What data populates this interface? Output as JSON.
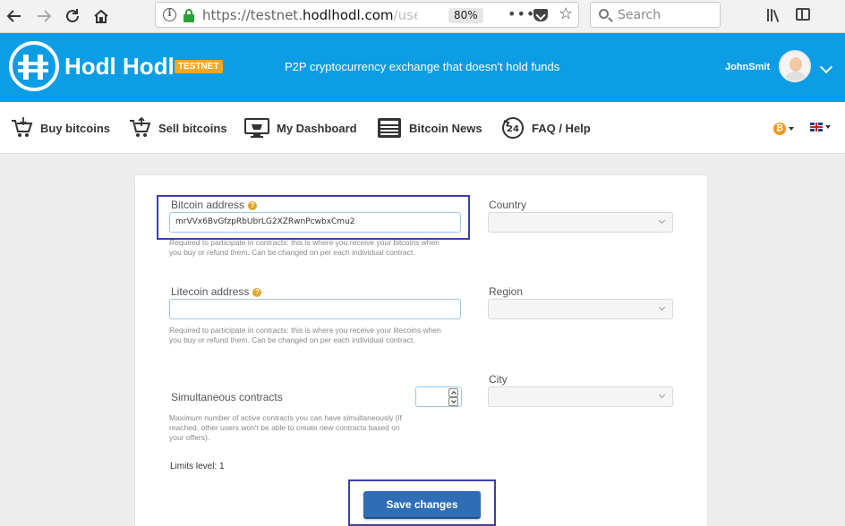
{
  "browser": {
    "url_prefix": "https://testnet.",
    "url_domain": "hodlhodl.com",
    "url_suffix": "/user",
    "zoom": "80%",
    "search_placeholder": "Search",
    "page_actions": "•••"
  },
  "header": {
    "brand": "Hodl Hodl",
    "badge": "TESTNET",
    "tagline": "P2P cryptocurrency exchange that doesn't hold funds",
    "username": "JohnSmit"
  },
  "nav": {
    "items": [
      {
        "label": "Buy bitcoins"
      },
      {
        "label": "Sell bitcoins"
      },
      {
        "label": "My Dashboard"
      },
      {
        "label": "Bitcoin News"
      },
      {
        "label": "FAQ / Help"
      }
    ],
    "currency_symbol": "₿"
  },
  "form": {
    "bitcoin": {
      "label": "Bitcoin address",
      "help": "?",
      "value": "mrVVx6BvGfzpRbUbrLG2XZRwnPcwbxCmu2",
      "hint": "Required to participate in contracts: this is where you receive your bitcoins when you buy or refund them. Can be changed on per each individual contract."
    },
    "litecoin": {
      "label": "Litecoin address",
      "help": "?",
      "value": "",
      "hint": "Required to participate in contracts: this is where you receive your litecoins when you buy or refund them. Can be changed on per each individual contract."
    },
    "contracts": {
      "label": "Simultaneous contracts",
      "value": "",
      "hint": "Maximum number of active contracts you can have simultaneously (if reached, other users won't be able to create new contracts based on your offers)."
    },
    "country": {
      "label": "Country",
      "value": ""
    },
    "region": {
      "label": "Region",
      "value": ""
    },
    "city": {
      "label": "City",
      "value": ""
    },
    "limits": "Limits level: 1",
    "save_label": "Save changes"
  },
  "colors": {
    "header_blue": "#0c9de4",
    "badge_orange": "#f6a723",
    "button_blue": "#2f6eb5",
    "highlight": "#3b3fa9"
  }
}
